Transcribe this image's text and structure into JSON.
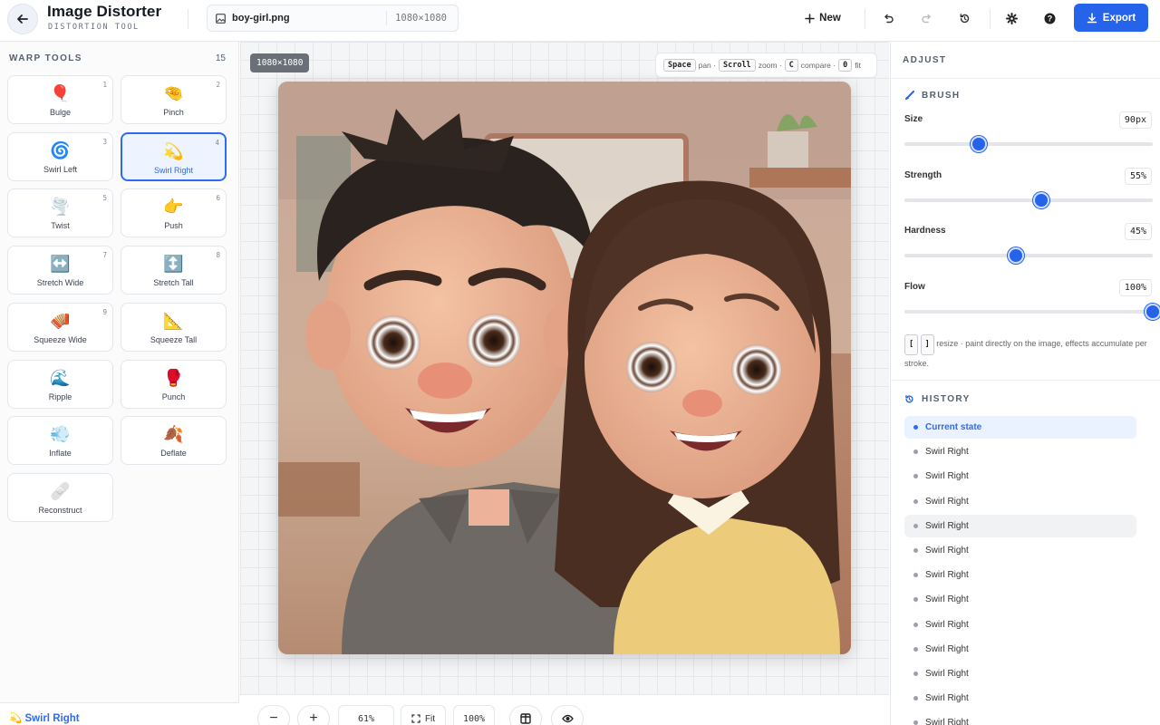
{
  "header": {
    "title": "Image Distorter",
    "subtitle": "DISTORTION TOOL",
    "file_name": "boy-girl.png",
    "file_dims": "1080×1080",
    "new_label": "New",
    "export_label": "Export"
  },
  "tools": {
    "title": "WARP TOOLS",
    "count": "15",
    "items": [
      {
        "label": "Bulge",
        "num": "1",
        "emoji": "🎈"
      },
      {
        "label": "Pinch",
        "num": "2",
        "emoji": "🤏"
      },
      {
        "label": "Swirl Left",
        "num": "3",
        "emoji": "🌀"
      },
      {
        "label": "Swirl Right",
        "num": "4",
        "emoji": "💫",
        "active": true
      },
      {
        "label": "Twist",
        "num": "5",
        "emoji": "🌪️"
      },
      {
        "label": "Push",
        "num": "6",
        "emoji": "👉"
      },
      {
        "label": "Stretch Wide",
        "num": "7",
        "emoji": "↔️"
      },
      {
        "label": "Stretch Tall",
        "num": "8",
        "emoji": "↕️"
      },
      {
        "label": "Squeeze Wide",
        "num": "9",
        "emoji": "🪗"
      },
      {
        "label": "Squeeze Tall",
        "num": "",
        "emoji": "📐"
      },
      {
        "label": "Ripple",
        "num": "",
        "emoji": "🌊"
      },
      {
        "label": "Punch",
        "num": "",
        "emoji": "🥊"
      },
      {
        "label": "Inflate",
        "num": "",
        "emoji": "💨"
      },
      {
        "label": "Deflate",
        "num": "",
        "emoji": "🍂"
      },
      {
        "label": "Reconstruct",
        "num": "",
        "emoji": "🩹"
      }
    ],
    "selected_label": "💫 Swirl Right"
  },
  "canvas": {
    "dims_badge": "1080×1080",
    "hints": {
      "space_key": "Space",
      "space_text": "pan ·",
      "scroll_key": "Scroll",
      "scroll_text": "zoom ·",
      "c_key": "C",
      "c_text": "compare ·",
      "zero_key": "0",
      "zero_text": "fit"
    }
  },
  "bottom": {
    "zoom_minus": "−",
    "zoom_plus": "+",
    "zoom_value": "61%",
    "fit_label": "Fit",
    "hundred_label": "100%"
  },
  "adjust": {
    "title": "ADJUST",
    "brush_title": "BRUSH",
    "controls": [
      {
        "label": "Size",
        "value": "90px",
        "level": 0.3
      },
      {
        "label": "Strength",
        "value": "55%",
        "level": 0.55
      },
      {
        "label": "Hardness",
        "value": "45%",
        "level": 0.45
      },
      {
        "label": "Flow",
        "value": "100%",
        "level": 1.0
      }
    ],
    "note_key1": "[",
    "note_key2": "]",
    "note_text": "resize · paint directly on the image, effects accumulate per stroke."
  },
  "history": {
    "title": "HISTORY",
    "items": [
      "Current state",
      "Swirl Right",
      "Swirl Right",
      "Swirl Right",
      "Swirl Right",
      "Swirl Right",
      "Swirl Right",
      "Swirl Right",
      "Swirl Right",
      "Swirl Right",
      "Swirl Right",
      "Swirl Right",
      "Swirl Right"
    ]
  },
  "colors": {
    "accent": "#2563eb",
    "active_tool_bg": "#edf3ff"
  }
}
